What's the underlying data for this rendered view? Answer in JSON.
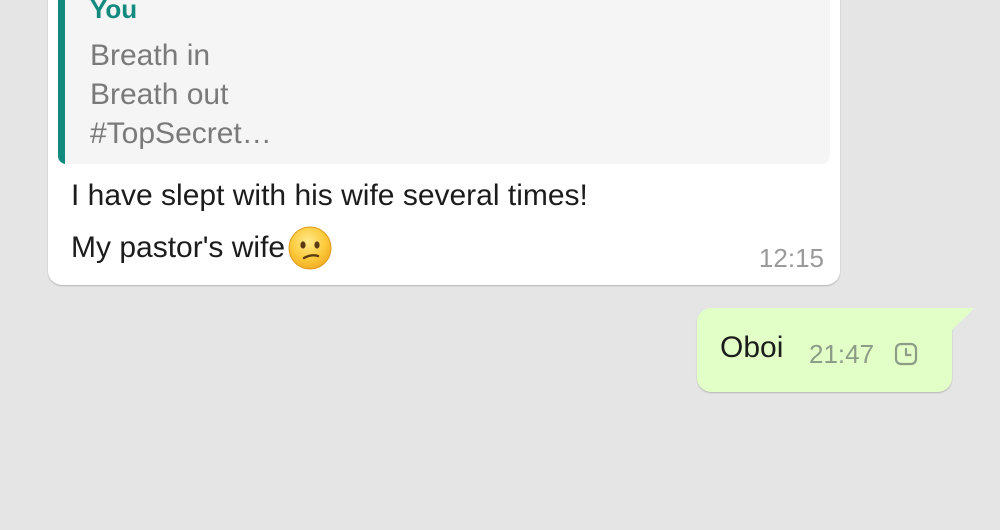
{
  "chat": {
    "incoming": {
      "quote": {
        "author": "You",
        "lines": [
          "Breath in",
          "Breath out",
          "#TopSecret…"
        ]
      },
      "lines": [
        "I have slept with his wife several times!",
        "My pastor's wife"
      ],
      "emoji": "confused-face-emoji",
      "time": "12:15"
    },
    "outgoing": {
      "text": "Oboi",
      "time": "21:47",
      "status_icon": "clock-icon"
    }
  },
  "colors": {
    "background": "#e5e5e5",
    "incoming_bubble": "#ffffff",
    "outgoing_bubble": "#e2ffc7",
    "quote_accent": "#128a7e"
  }
}
